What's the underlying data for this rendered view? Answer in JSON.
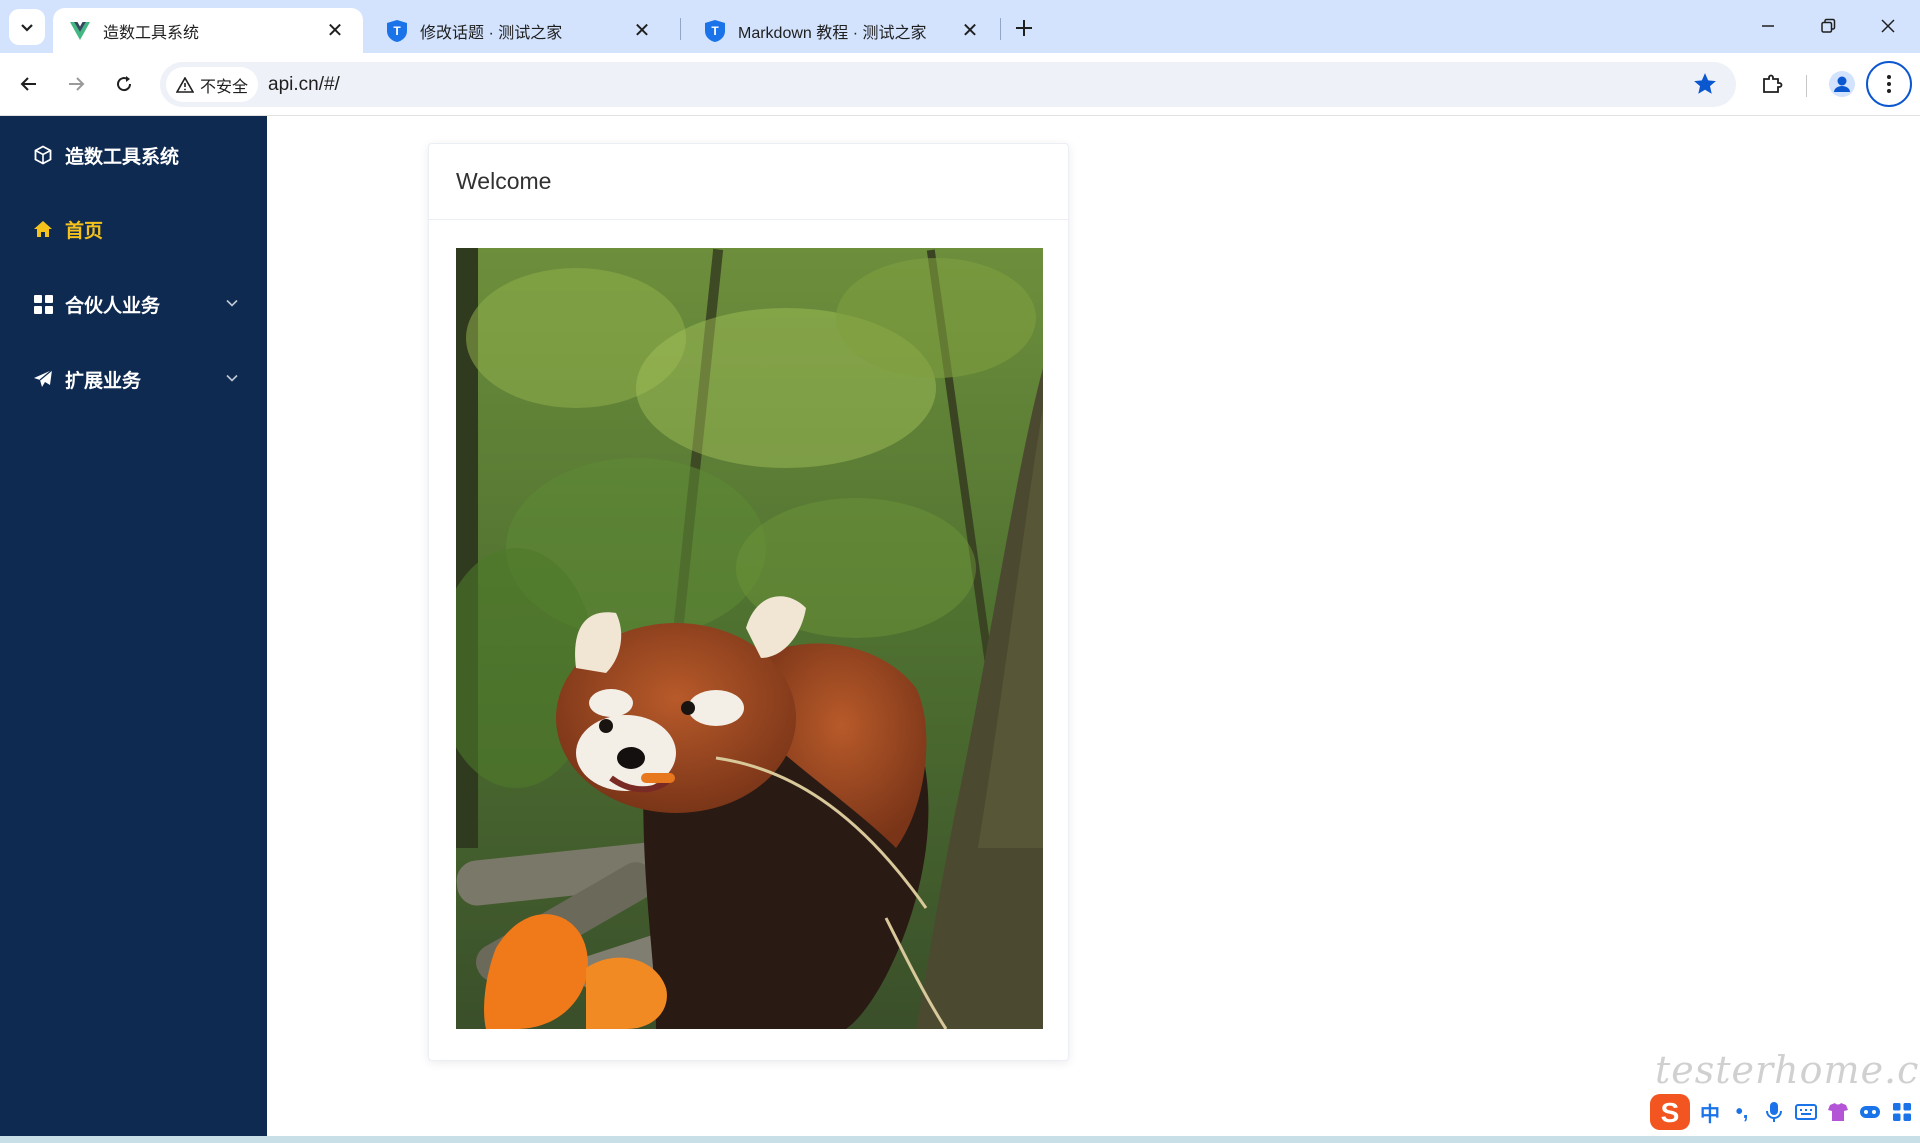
{
  "browser": {
    "tabs": [
      {
        "title": "造数工具系统",
        "favicon": "vue-icon",
        "active": true
      },
      {
        "title": "修改话题 · 测试之家",
        "favicon": "testerhome-shield-icon",
        "active": false
      },
      {
        "title": "Markdown 教程 · 测试之家",
        "favicon": "testerhome-shield-icon",
        "active": false
      }
    ],
    "security_label": "不安全",
    "url": "api.cn/#/",
    "bookmarked": true
  },
  "sidebar": {
    "brand": "造数工具系统",
    "items": [
      {
        "label": "首页",
        "icon": "home-icon",
        "active": true
      },
      {
        "label": "合伙人业务",
        "icon": "grid-icon",
        "expandable": true
      },
      {
        "label": "扩展业务",
        "icon": "paper-plane-icon",
        "expandable": true
      }
    ]
  },
  "main": {
    "card_title": "Welcome",
    "image_alt": "red-panda-photo"
  },
  "overlay": {
    "watermark": "testerhome.com",
    "ime_label": "中"
  },
  "colors": {
    "tabstrip": "#d3e3fd",
    "sidebar_bg": "#0e2a50",
    "active_menu": "#f5c21b",
    "accent_blue": "#0b57d0"
  }
}
